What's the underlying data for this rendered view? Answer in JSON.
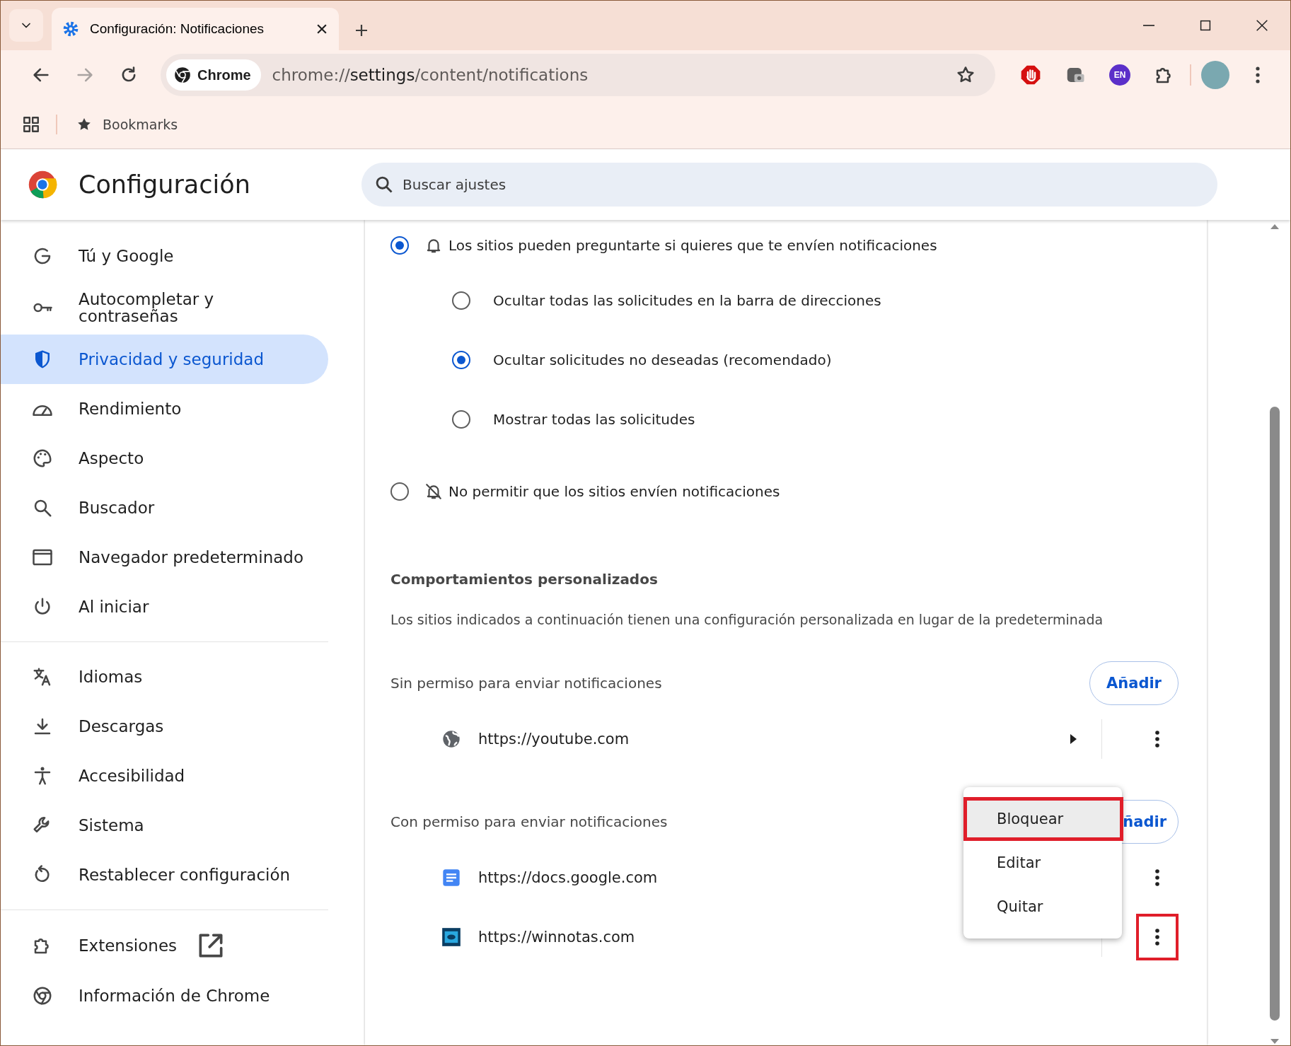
{
  "tabs": [
    {
      "title": "Configuración: Notificaciones",
      "selected": true
    }
  ],
  "toolbar": {
    "chip": "Chrome",
    "url": {
      "scheme": "chrome://",
      "host": "settings",
      "path": "/content/notifications"
    },
    "extensions": [
      {
        "kind": "stop"
      },
      {
        "kind": "camera"
      },
      {
        "kind": "badge",
        "label": "EN"
      },
      {
        "kind": "puzzle"
      }
    ]
  },
  "bookmarks_bar": {
    "items": [
      {
        "label": "Bookmarks"
      }
    ]
  },
  "header": {
    "title": "Configuración",
    "search_placeholder": "Buscar ajustes"
  },
  "sidebar": {
    "groups": [
      [
        {
          "label": "Tú y Google",
          "selected": false
        },
        {
          "label": "Autocompletar y contraseñas",
          "selected": false
        },
        {
          "label": "Privacidad y seguridad",
          "selected": true
        },
        {
          "label": "Rendimiento",
          "selected": false
        },
        {
          "label": "Aspecto",
          "selected": false
        },
        {
          "label": "Buscador",
          "selected": false
        },
        {
          "label": "Navegador predeterminado",
          "selected": false
        },
        {
          "label": "Al iniciar",
          "selected": false
        }
      ],
      [
        {
          "label": "Idiomas",
          "selected": false
        },
        {
          "label": "Descargas",
          "selected": false
        },
        {
          "label": "Accesibilidad",
          "selected": false
        },
        {
          "label": "Sistema",
          "selected": false
        },
        {
          "label": "Restablecer configuración",
          "selected": false
        }
      ],
      [
        {
          "label": "Extensiones",
          "selected": false,
          "external": true
        },
        {
          "label": "Información de Chrome",
          "selected": false,
          "external": false
        }
      ]
    ]
  },
  "options": [
    {
      "label": "Los sitios pueden preguntarte si quieres que te envíen notificaciones",
      "selected": true,
      "children": [
        {
          "label": "Ocultar todas las solicitudes en la barra de direcciones",
          "selected": false
        },
        {
          "label": "Ocultar solicitudes no deseadas (recomendado)",
          "selected": true
        },
        {
          "label": "Mostrar todas las solicitudes",
          "selected": false
        }
      ]
    },
    {
      "label": "No permitir que los sitios envíen notificaciones",
      "selected": false
    }
  ],
  "custom": {
    "title": "Comportamientos personalizados",
    "description": "Los sitios indicados a continuación tienen una configuración personalizada en lugar de la predeterminada",
    "sections": [
      {
        "label": "Sin permiso para enviar notificaciones",
        "button": "Añadir",
        "sites": [
          {
            "url": "https://youtube.com",
            "expandable": true,
            "annotated": false
          }
        ]
      },
      {
        "label": "Con permiso para enviar notificaciones",
        "button": "ñadir",
        "sites": [
          {
            "url": "https://docs.google.com",
            "expandable": false,
            "annotated": false
          },
          {
            "url": "https://winnotas.com",
            "expandable": false,
            "annotated": true
          }
        ]
      }
    ]
  },
  "menu": {
    "items": [
      {
        "label": "Bloquear",
        "highlighted": true,
        "annotated": true
      },
      {
        "label": "Editar",
        "highlighted": false,
        "annotated": false
      },
      {
        "label": "Quitar",
        "highlighted": false,
        "annotated": false
      }
    ]
  }
}
